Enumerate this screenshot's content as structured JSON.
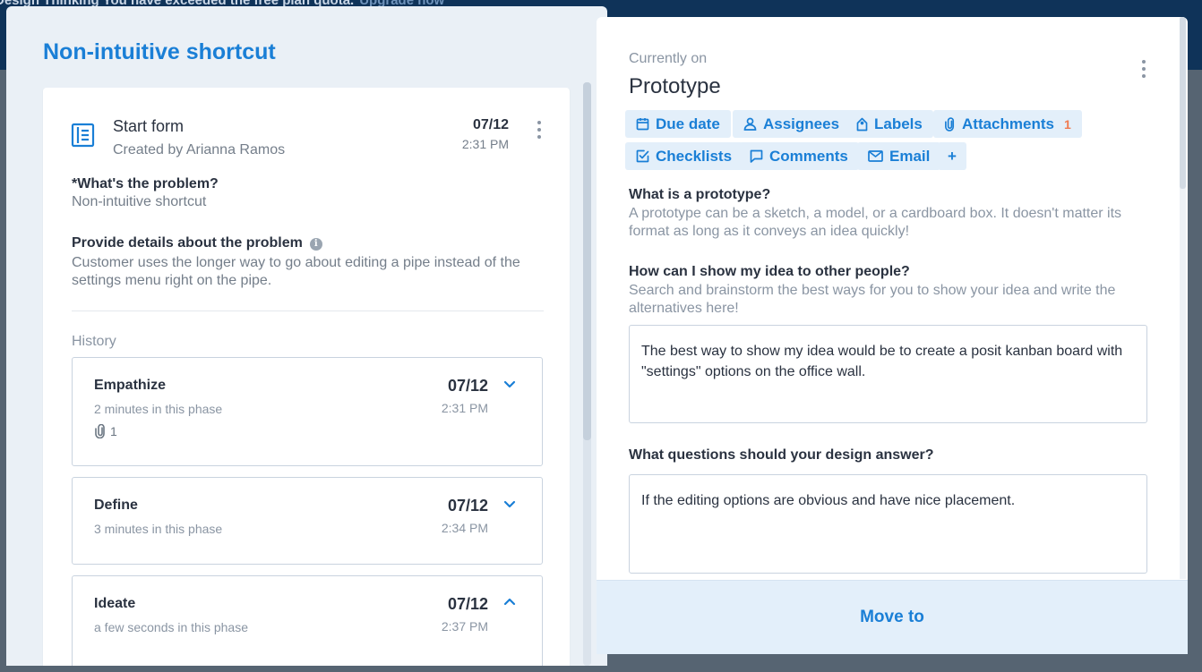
{
  "background": {
    "banner_text": "Design Thinking You have exceeded the free plan quota.",
    "banner_link": "Upgrade now"
  },
  "card": {
    "title": "Non-intuitive shortcut",
    "start_form": {
      "name": "Start form",
      "created_by": "Created by Arianna Ramos",
      "date": "07/12",
      "time": "2:31 PM"
    },
    "fields": [
      {
        "label": "*What's the problem?",
        "value": "Non-intuitive shortcut"
      },
      {
        "label": "Provide details about the problem",
        "value": "Customer uses the longer way to go about editing a pipe instead of the settings menu right on the pipe."
      }
    ],
    "history_label": "History",
    "history": [
      {
        "name": "Empathize",
        "duration": "2 minutes in this phase",
        "date": "07/12",
        "time": "2:31 PM",
        "attachments": "1",
        "expanded": false
      },
      {
        "name": "Define",
        "duration": "3 minutes in this phase",
        "date": "07/12",
        "time": "2:34 PM",
        "expanded": false
      },
      {
        "name": "Ideate",
        "duration": "a few seconds in this phase",
        "date": "07/12",
        "time": "2:37 PM",
        "expanded": true
      }
    ]
  },
  "current_phase": {
    "label": "Currently on",
    "name": "Prototype",
    "actions": {
      "due_date": "Due date",
      "assignees": "Assignees",
      "labels": "Labels",
      "attachments": "Attachments",
      "attachments_count": "1",
      "checklists": "Checklists",
      "comments": "Comments",
      "email": "Email",
      "add": "+"
    },
    "questions": [
      {
        "label": "What is a prototype?",
        "description": "A prototype can be a sketch, a model, or a cardboard box. It doesn't matter its format as long as it conveys an idea quickly!"
      },
      {
        "label": "How can I show my idea to other people?",
        "description": "Search and brainstorm the best ways for you to show your idea and write the alternatives here!",
        "answer": "The best way to show my idea would be to create a posit kanban board with \"settings\" options on the office wall."
      },
      {
        "label": "What questions should your design answer?",
        "answer": "If the editing options are obvious and have nice placement."
      }
    ],
    "move_to": "Move to"
  },
  "colors": {
    "accent": "#1a7fd6",
    "chip_bg": "#e3effa",
    "badge": "#f07a50",
    "banner": "#0f3359"
  }
}
